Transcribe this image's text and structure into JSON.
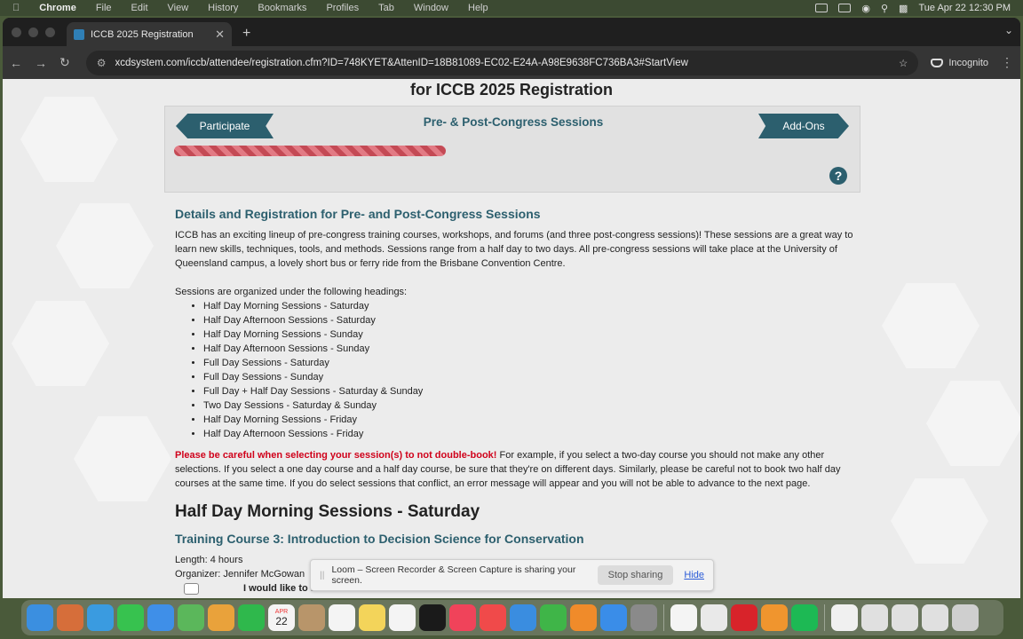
{
  "menubar": {
    "app": "Chrome",
    "items": [
      "File",
      "Edit",
      "View",
      "History",
      "Bookmarks",
      "Profiles",
      "Tab",
      "Window",
      "Help"
    ],
    "datetime": "Tue Apr 22  12:30 PM"
  },
  "browser": {
    "tab_title": "ICCB 2025 Registration",
    "new_tab": "+",
    "url": "xcdsystem.com/iccb/attendee/registration.cfm?ID=748KYET&AttenID=18B81089-EC02-E24A-A98E9638FC736BA3#StartView",
    "incognito_label": "Incognito"
  },
  "page": {
    "title": "for ICCB 2025 Registration",
    "progress": {
      "prev_label": "Participate",
      "stage_title": "Pre- & Post-Congress Sessions",
      "next_label": "Add-Ons",
      "help_icon": "?",
      "fraction": 0.4
    },
    "details_heading": "Details and Registration for Pre- and Post-Congress Sessions",
    "intro": "ICCB has an exciting lineup of pre-congress training courses, workshops, and forums (and three post-congress sessions)! These sessions are a great way to learn new skills, techniques, tools, and methods. Sessions range from a half day to two days. All pre-congress sessions will take place at the University of Queensland campus, a lovely short bus or ferry ride from the Brisbane Convention Centre.",
    "headings_intro": "Sessions are organized under the following headings:",
    "headings": [
      "Half Day Morning Sessions - Saturday",
      "Half Day Afternoon Sessions - Saturday",
      "Half Day Morning Sessions - Sunday",
      "Half Day Afternoon Sessions - Sunday",
      "Full Day Sessions - Saturday",
      "Full Day Sessions - Sunday",
      "Full Day + Half Day Sessions - Saturday & Sunday",
      "Two Day Sessions - Saturday & Sunday",
      "Half Day Morning Sessions - Friday",
      "Half Day Afternoon Sessions - Friday"
    ],
    "warning_strong": "Please be careful when selecting your session(s) to not double-book!",
    "warning_text": " For example, if you select a two-day course you should not make any other selections. If you select a one day course and a half day course, be sure that they're on different days. Similarly, please be careful not to book two half day courses at the same time. If you do select sessions that conflict, an error message will appear and you will not be able to advance to the next page.",
    "section_heading": "Half Day Morning Sessions - Saturday",
    "course_title": "Training Course 3: Introduction to Decision Science for Conservation",
    "course_length": "Length: 4 hours",
    "course_organizer": "Organizer: Jennifer McGowan",
    "attend_label": "I would like to attend Introduction to Decision Science for Conservation"
  },
  "loom": {
    "grip": "||",
    "message": "Loom – Screen Recorder & Screen Capture is sharing your screen.",
    "stop": "Stop sharing",
    "hide": "Hide"
  },
  "dock": {
    "calendar_month": "APR",
    "calendar_day": "22",
    "apps": [
      "finder-icon",
      "launchpad-icon",
      "safari-icon",
      "messages-icon",
      "mail-icon",
      "maps-icon",
      "photos-icon",
      "facetime-icon",
      "calendar-icon",
      "contacts-icon",
      "reminders-icon",
      "notes-icon",
      "freeform-icon",
      "tv-icon",
      "music-icon",
      "news-icon",
      "keynote-icon",
      "numbers-icon",
      "pages-icon",
      "app-store-icon",
      "system-settings-icon",
      "slack-icon",
      "chrome-icon",
      "acrobat-icon",
      "sublime-icon",
      "spotify-icon"
    ],
    "colors": {
      "finder": "#3b8fe0",
      "launchpad": "#d66e3a",
      "safari": "#3a9be0",
      "messages": "#37c24f",
      "mail": "#3f8fe8",
      "maps": "#5bb75b",
      "photos": "#e9a23b",
      "facetime": "#2fb84c",
      "calendar": "#f4f4f4",
      "contacts": "#b8956a",
      "reminders": "#f4f4f4",
      "notes": "#f3d45a",
      "freeform": "#f4f4f4",
      "tv": "#1a1a1a",
      "music": "#f0435a",
      "news": "#f04a4a",
      "keynote": "#3a8de0",
      "numbers": "#3fb548",
      "pages": "#f08b2a",
      "appstore": "#3a8de8",
      "settings": "#8a8a8a",
      "slack": "#f4f4f4",
      "chrome": "#e9e9e9",
      "acrobat": "#d8232a",
      "sublime": "#f0952e",
      "spotify": "#1db954",
      "trash": "#cfcfcf"
    }
  },
  "theme": {
    "accent": "#2c5f6e",
    "warning": "#d0021b",
    "progress_bar": "#c44a55"
  }
}
